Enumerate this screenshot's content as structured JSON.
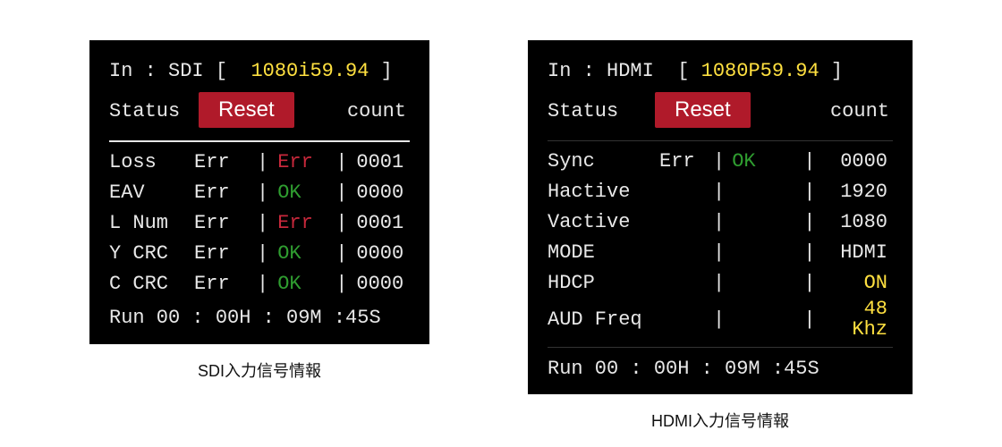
{
  "sdi": {
    "in_label": "In :",
    "in_type": "SDI",
    "bracket_open": "[",
    "bracket_close": "]",
    "resolution": "1080i59.94",
    "status_label": "Status",
    "reset_label": "Reset",
    "count_label": "count",
    "rows": [
      {
        "name": "Loss",
        "errlbl": "Err",
        "status": "Err",
        "status_class": "c-red",
        "count": "0001"
      },
      {
        "name": "EAV",
        "errlbl": "Err",
        "status": "OK",
        "status_class": "c-green",
        "count": "0000"
      },
      {
        "name": "L Num",
        "errlbl": "Err",
        "status": "Err",
        "status_class": "c-red",
        "count": "0001"
      },
      {
        "name": "Y CRC",
        "errlbl": "Err",
        "status": "OK",
        "status_class": "c-green",
        "count": "0000"
      },
      {
        "name": "C CRC",
        "errlbl": "Err",
        "status": "OK",
        "status_class": "c-green",
        "count": "0000"
      }
    ],
    "run_line": "Run 00 : 00H : 09M :45S",
    "caption": "SDI入力信号情報"
  },
  "hdmi": {
    "in_label": "In :",
    "in_type": "HDMI",
    "bracket_open": "[",
    "bracket_close": "]",
    "resolution": "1080P59.94",
    "status_label": "Status",
    "reset_label": "Reset",
    "count_label": "count",
    "rows": [
      {
        "name": "Sync",
        "errlbl": "Err",
        "status": "OK",
        "status_class": "c-green",
        "value": "0000",
        "value_class": "c-white"
      },
      {
        "name": "Hactive",
        "errlbl": "",
        "status": "",
        "status_class": "",
        "value": "1920",
        "value_class": "c-white"
      },
      {
        "name": "Vactive",
        "errlbl": "",
        "status": "",
        "status_class": "",
        "value": "1080",
        "value_class": "c-white"
      },
      {
        "name": "MODE",
        "errlbl": "",
        "status": "",
        "status_class": "",
        "value": "HDMI",
        "value_class": "c-white"
      },
      {
        "name": "HDCP",
        "errlbl": "",
        "status": "",
        "status_class": "",
        "value": "ON",
        "value_class": "c-yellow"
      },
      {
        "name": "AUD Freq",
        "errlbl": "",
        "status": "",
        "status_class": "",
        "value": "48 Khz",
        "value_class": "c-yellow"
      }
    ],
    "run_line": "Run 00 : 00H : 09M :45S",
    "caption": "HDMI入力信号情報"
  },
  "separator": "|"
}
